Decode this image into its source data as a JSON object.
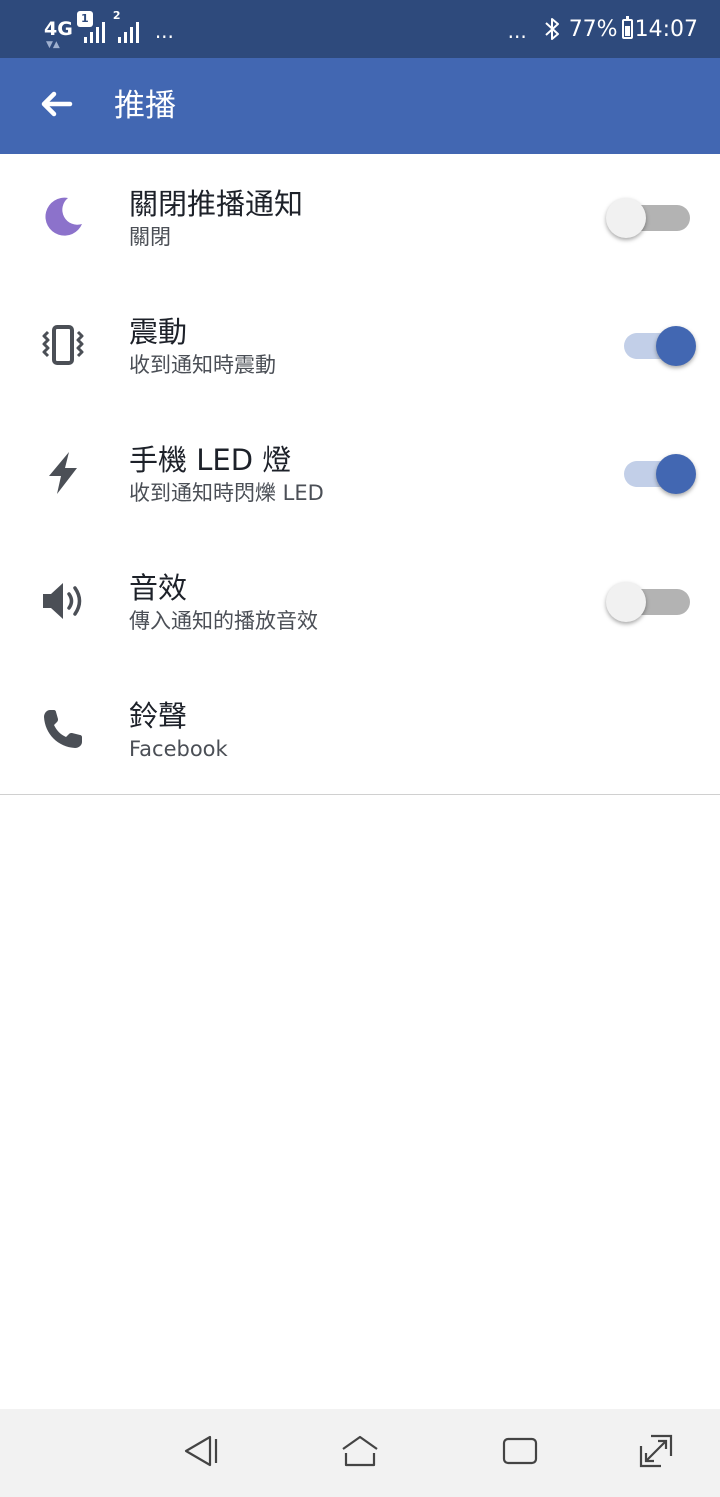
{
  "status_bar": {
    "network": "4G",
    "sim1_badge": "1",
    "sim2_label": "2",
    "left_more": "...",
    "right_more": "...",
    "bluetooth_icon": "bluetooth-icon",
    "battery_percent": "77%",
    "time": "14:07"
  },
  "app_bar": {
    "title": "推播",
    "back_icon": "arrow-left-icon",
    "color": "#4267b2"
  },
  "settings": [
    {
      "icon": "moon-icon",
      "icon_color": "#8c72cb",
      "title": "關閉推播通知",
      "subtitle": "關閉",
      "toggle": false
    },
    {
      "icon": "vibration-icon",
      "icon_color": "#4b4f56",
      "title": "震動",
      "subtitle": "收到通知時震動",
      "toggle": true
    },
    {
      "icon": "lightning-icon",
      "icon_color": "#4b4f56",
      "title": "手機 LED 燈",
      "subtitle": "收到通知時閃爍 LED",
      "toggle": true
    },
    {
      "icon": "speaker-icon",
      "icon_color": "#4b4f56",
      "title": "音效",
      "subtitle": "傳入通知的播放音效",
      "toggle": false
    },
    {
      "icon": "phone-icon",
      "icon_color": "#4b4f56",
      "title": "鈴聲",
      "subtitle": "Facebook",
      "toggle": null
    }
  ],
  "nav_bar": {
    "back": "nav-back-icon",
    "home": "nav-home-icon",
    "recents": "nav-recents-icon",
    "expand": "nav-expand-icon"
  },
  "colors": {
    "status_bar": "#2e4a7c",
    "accent": "#4267b2"
  }
}
